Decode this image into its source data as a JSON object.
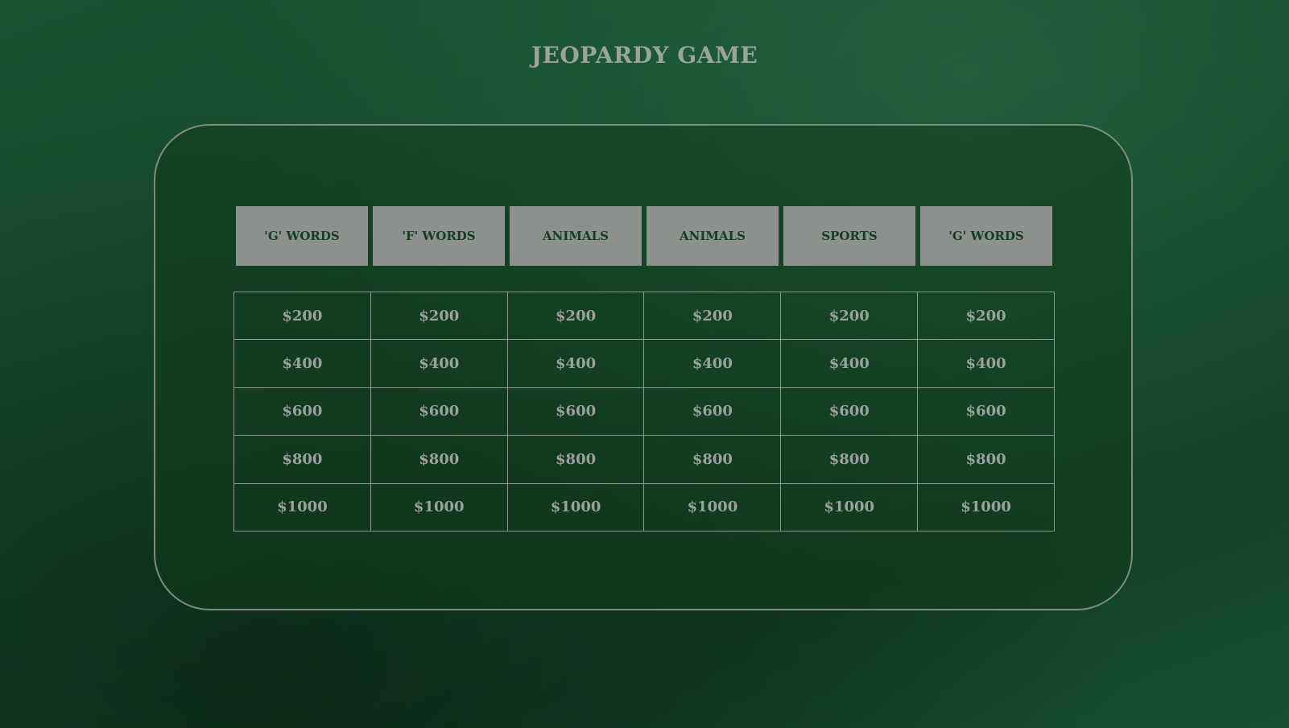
{
  "header": {
    "title": "JEOPARDY GAME"
  },
  "board": {
    "categories": [
      "'G' WORDS",
      "'F' WORDS",
      "ANIMALS",
      "ANIMALS",
      "SPORTS",
      "'G' WORDS"
    ],
    "values": [
      "$200",
      "$400",
      "$600",
      "$800",
      "$1000"
    ]
  },
  "colors": {
    "background": "#15482c",
    "category_bg": "#8c918e",
    "category_text": "#143d23",
    "value_text": "#9ba29d",
    "border": "#8d968f"
  }
}
